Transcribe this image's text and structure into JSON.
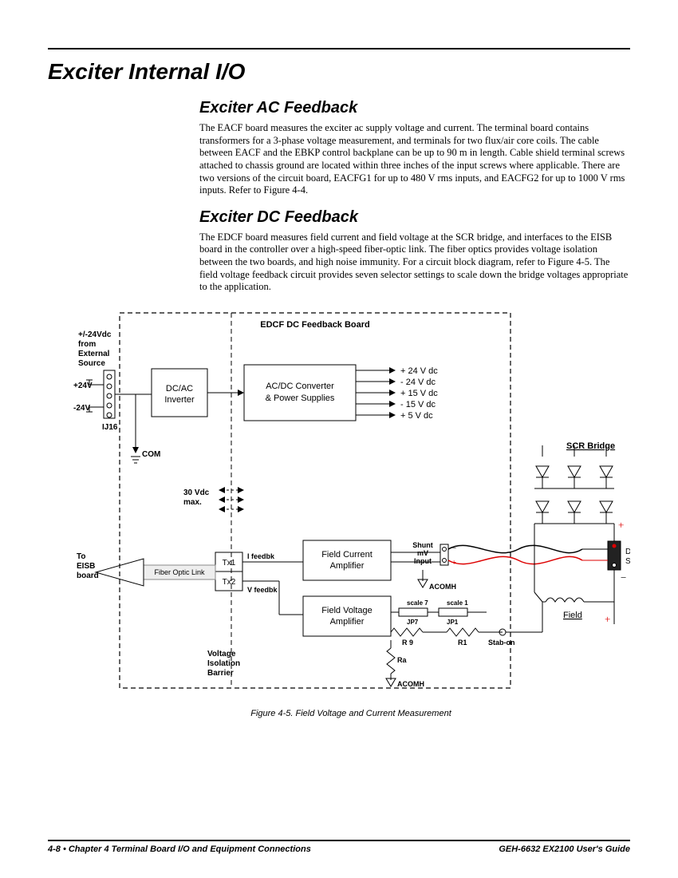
{
  "title": "Exciter Internal I/O",
  "sections": {
    "ac": {
      "heading": "Exciter AC Feedback",
      "text": "The EACF board measures the exciter ac supply voltage and current. The terminal board contains transformers for a 3-phase voltage measurement, and terminals for two flux/air core coils. The cable between EACF and the EBKP control backplane can be up to 90 m in length. Cable shield terminal screws attached to chassis ground are located within three inches of the input screws where applicable. There are two versions of the circuit board, EACFG1 for up to 480 V rms inputs, and EACFG2 for up to 1000 V rms inputs. Refer to Figure 4-4."
    },
    "dc": {
      "heading": "Exciter DC Feedback",
      "text": "The EDCF board measures field current and field voltage at the SCR bridge, and interfaces to the EISB board in the controller over a high-speed fiber-optic link. The fiber optics provides voltage isolation between the two boards, and high noise immunity. For a circuit block diagram, refer to Figure 4-5. The field voltage feedback circuit provides seven selector settings to scale down the bridge voltages appropriate to the application."
    }
  },
  "diagram": {
    "board_title": "EDCF DC Feedback Board",
    "external": {
      "label1": "+/-24Vdc",
      "label2": "from",
      "label3": "External",
      "label4": "Source",
      "plus24": "+24V",
      "minus24": "-24V",
      "ij16": "IJ16",
      "com": "COM"
    },
    "inverter": "DC/AC Inverter",
    "converter": "AC/DC Converter & Power Supplies",
    "rails": {
      "r1": "+ 24  V dc",
      "r2": "- 24  V dc",
      "r3": "+ 15  V dc",
      "r4": "- 15  V dc",
      "r5": "+  5  V dc"
    },
    "thirty": "30 Vdc max.",
    "fc_amp": "Field Current Amplifier",
    "fv_amp": "Field Voltage Amplifier",
    "tx1": "Tx1",
    "tx2": "Tx2",
    "ifb": "I feedbk",
    "vfb": "V feedbk",
    "fol": "Fiber Optic Link",
    "to1": "To",
    "to2": "EISB",
    "to3": "board",
    "vib1": "Voltage",
    "vib2": "Isolation",
    "vib3": "Barrier",
    "shunt1": "Shunt",
    "shunt2": "mV",
    "shunt3": "Input",
    "acomh": "ACOMH",
    "scale7": "scale 7",
    "scale1": "scale 1",
    "jp7": "JP7",
    "jp1": "JP1",
    "r9": "R 9",
    "r1l": "R1",
    "ra": "Ra",
    "stabon": "Stab-on",
    "scr": "SCR Bridge",
    "dcshunt": "DC Shunt",
    "field": "Field",
    "plus": "+",
    "minus": "−"
  },
  "caption": "Figure 4-5.  Field Voltage and Current Measurement",
  "footer": {
    "left": "4-8 • Chapter 4 Terminal Board I/O and Equipment Connections",
    "right": "GEH-6632  EX2100 User's Guide"
  }
}
